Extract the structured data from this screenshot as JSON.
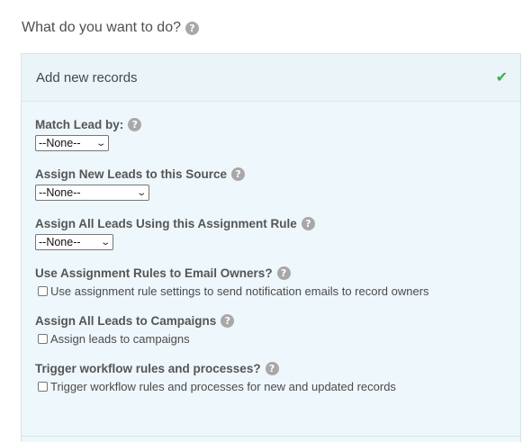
{
  "question": "What do you want to do?",
  "panel": {
    "title": "Add new records",
    "check_icon": "check-icon"
  },
  "fields": {
    "match_lead": {
      "label": "Match Lead by:",
      "value": "--None--"
    },
    "source": {
      "label": "Assign New Leads to this Source",
      "value": "--None--"
    },
    "assignment_rule": {
      "label": "Assign All Leads Using this Assignment Rule",
      "value": "--None--"
    },
    "email_owners": {
      "label": "Use Assignment Rules to Email Owners?",
      "checkbox_label": "Use assignment rule settings to send notification emails to record owners"
    },
    "campaigns": {
      "label": "Assign All Leads to Campaigns",
      "checkbox_label": "Assign leads to campaigns"
    },
    "workflow": {
      "label": "Trigger workflow rules and processes?",
      "checkbox_label": "Trigger workflow rules and processes for new and updated records"
    }
  },
  "help_glyph": "?",
  "colors": {
    "panel_bg": "#eef7fb",
    "check": "#3cb04a",
    "help_icon": "#a8a8a8"
  }
}
